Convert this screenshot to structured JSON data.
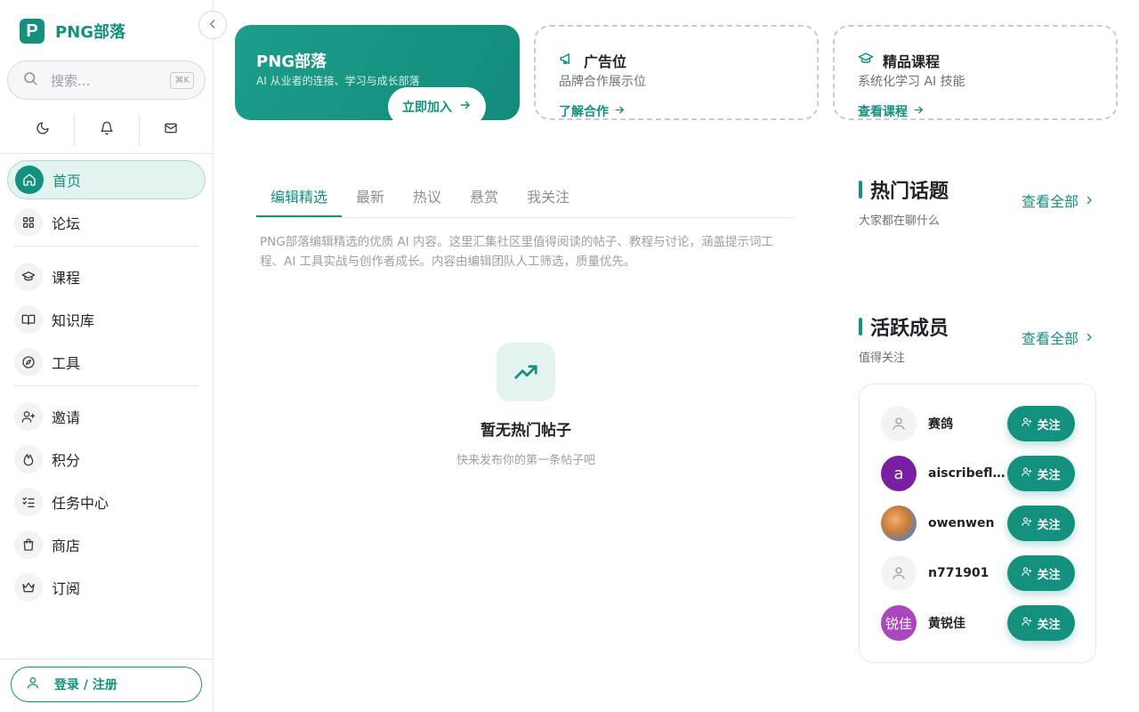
{
  "brand": {
    "name": "PNG部落",
    "logo_letter": "P",
    "accent": "#14907f"
  },
  "search": {
    "placeholder": "搜索...",
    "shortcut": "⌘K"
  },
  "quick_icons": [
    "moon-icon",
    "bell-icon",
    "mail-icon"
  ],
  "nav": {
    "group1": [
      {
        "label": "首页",
        "icon": "home-icon",
        "active": true
      },
      {
        "label": "论坛",
        "icon": "grid-icon"
      }
    ],
    "group2": [
      {
        "label": "课程",
        "icon": "graduation-cap-icon"
      },
      {
        "label": "知识库",
        "icon": "book-icon"
      },
      {
        "label": "工具",
        "icon": "compass-icon"
      }
    ],
    "group3": [
      {
        "label": "邀请",
        "icon": "user-plus-icon"
      },
      {
        "label": "积分",
        "icon": "flame-icon"
      },
      {
        "label": "任务中心",
        "icon": "list-check-icon"
      },
      {
        "label": "商店",
        "icon": "shopping-bag-icon"
      },
      {
        "label": "订阅",
        "icon": "crown-icon"
      }
    ]
  },
  "login": {
    "label": "登录 / 注册"
  },
  "hero": {
    "title": "PNG部落",
    "subtitle": "AI 从业者的连接、学习与成长部落",
    "button": "立即加入"
  },
  "promo_ad": {
    "title": "广告位",
    "subtitle": "品牌合作展示位",
    "link": "了解合作"
  },
  "promo_course": {
    "title": "精品课程",
    "subtitle": "系统化学习 AI 技能",
    "link": "查看课程"
  },
  "tabs": [
    "编辑精选",
    "最新",
    "热议",
    "悬赏",
    "我关注"
  ],
  "description": "PNG部落编辑精选的优质 AI 内容。这里汇集社区里值得阅读的帖子、教程与讨论，涵盖提示词工程、AI 工具实战与创作者成长。内容由编辑团队人工筛选，质量优先。",
  "empty": {
    "title": "暂无热门帖子",
    "subtitle": "快来发布你的第一条帖子吧"
  },
  "hot_topics": {
    "title": "热门话题",
    "subtitle": "大家都在聊什么",
    "more": "查看全部"
  },
  "active_members": {
    "title": "活跃成员",
    "subtitle": "值得关注",
    "more": "查看全部",
    "follow_label": "关注",
    "members": [
      {
        "name": "赛鸽",
        "avatar": "default"
      },
      {
        "name": "aiscribefl...",
        "avatar": "letter",
        "avatar_text": "a"
      },
      {
        "name": "owenwen",
        "avatar": "photo"
      },
      {
        "name": "n771901",
        "avatar": "default"
      },
      {
        "name": "黄锐佳",
        "avatar": "text",
        "avatar_text": "锐佳"
      }
    ]
  }
}
